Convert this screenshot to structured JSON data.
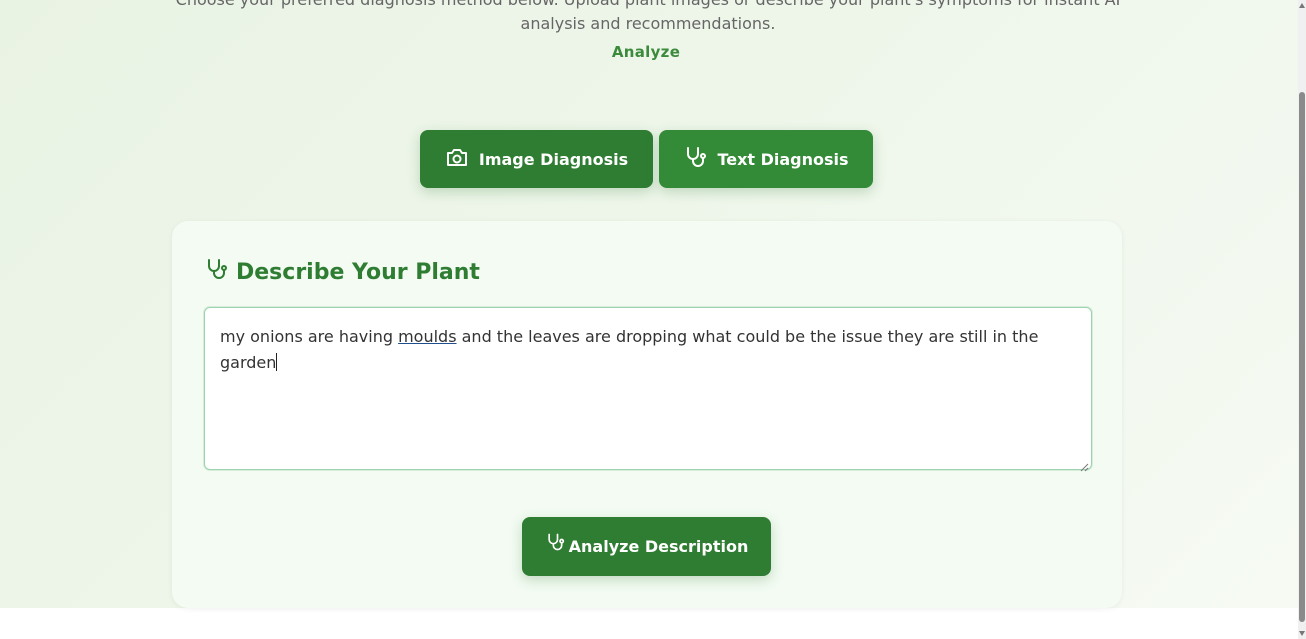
{
  "intro": {
    "line1": "Choose your preferred diagnosis method below. Upload plant images or describe your plant's symptoms for instant AI",
    "line2": "analysis and recommendations.",
    "analyze_link": "Analyze"
  },
  "modes": {
    "image_label": "Image Diagnosis",
    "text_label": "Text Diagnosis",
    "active": "text"
  },
  "card": {
    "title": "Describe Your Plant",
    "textarea": {
      "before": "my onions are having ",
      "underlined": "moulds",
      "after": " and the leaves are dropping what could be the issue they are still in the garden"
    },
    "submit_label": "Analyze Description"
  },
  "icons": {
    "image_mode": "camera-icon",
    "text_mode": "stethoscope-icon",
    "title": "stethoscope-icon",
    "submit": "stethoscope-icon"
  },
  "colors": {
    "brand": "#2f7d32",
    "title": "#2e7d32",
    "link": "#3c8a3c",
    "card_bg": "#f3fbf2",
    "textarea_border": "#9fd3b0"
  }
}
